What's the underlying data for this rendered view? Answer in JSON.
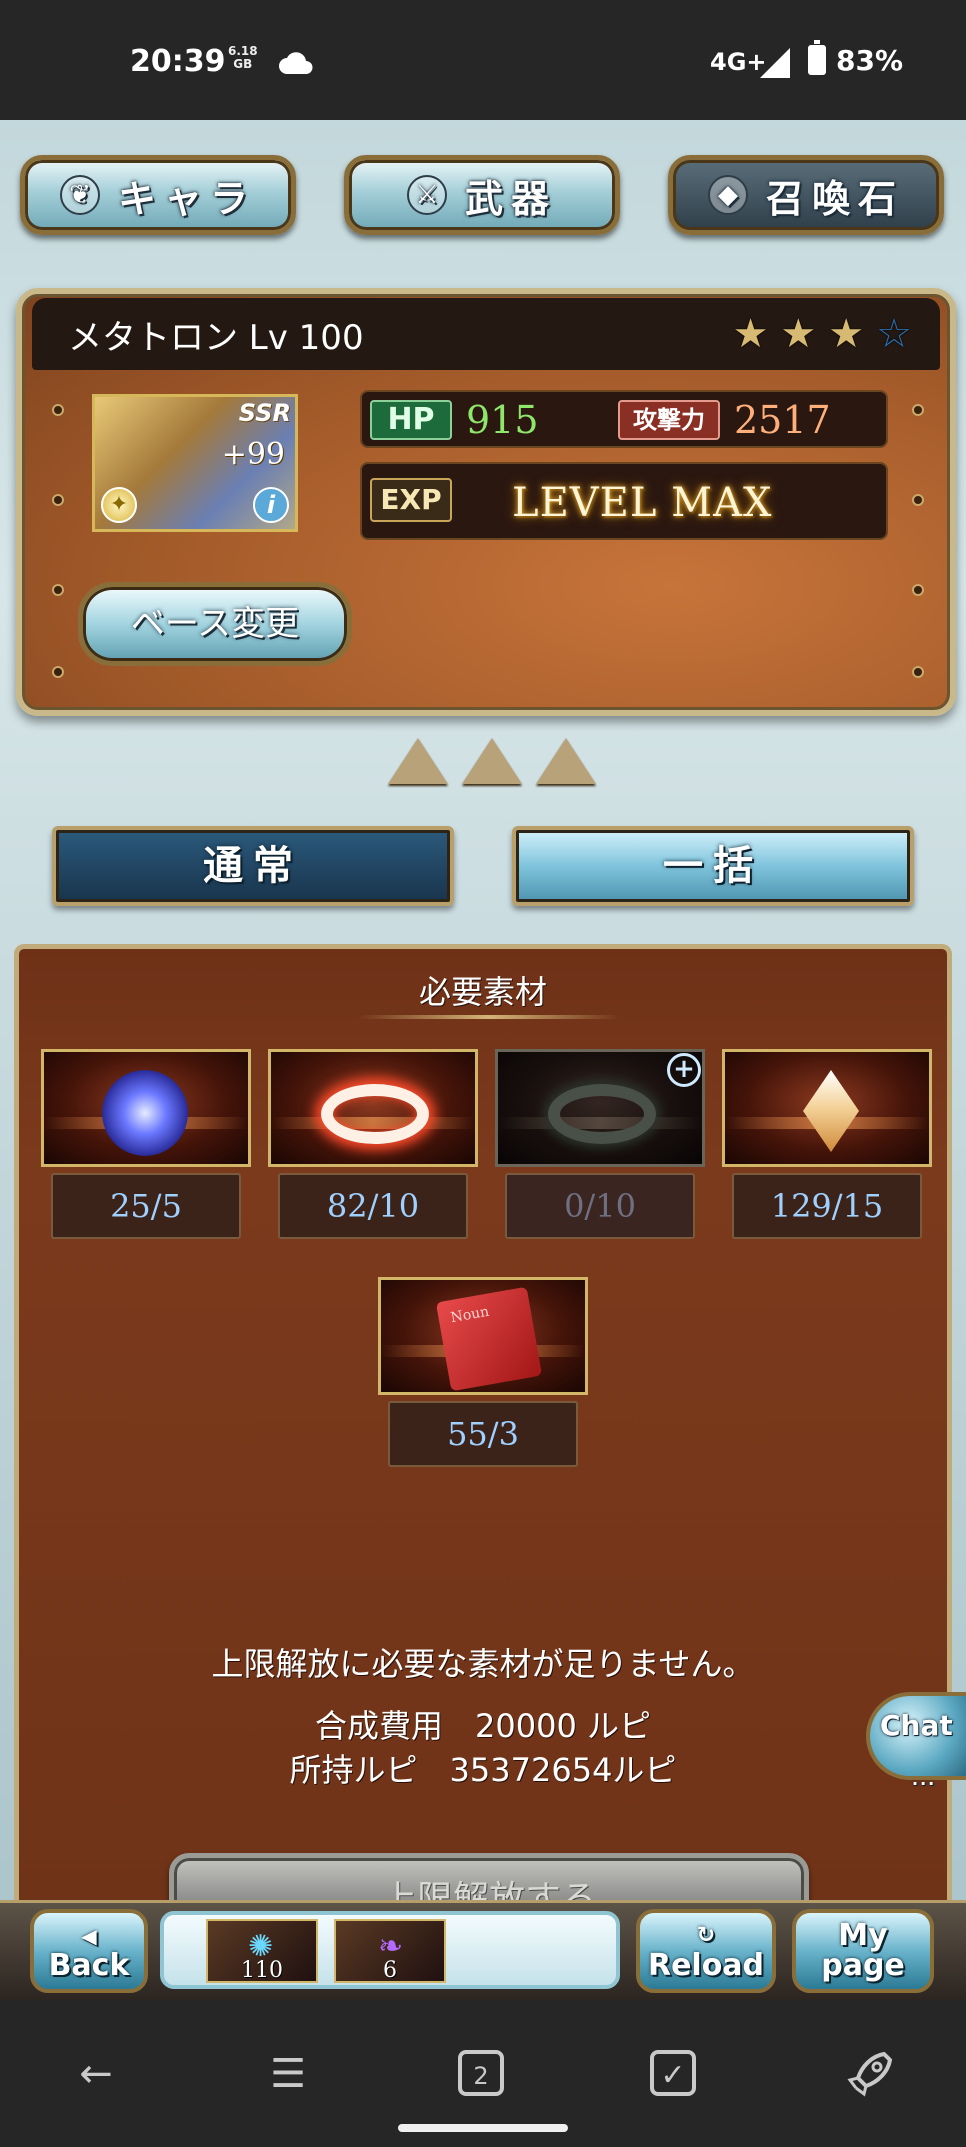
{
  "status_bar": {
    "time": "20:39",
    "net_speed": "6.18",
    "net_unit": "GB",
    "network": "4G+",
    "battery": "83%"
  },
  "top_tabs": [
    {
      "label": "キャラ",
      "icon": "character-icon",
      "active": false
    },
    {
      "label": "武器",
      "icon": "weapon-icon",
      "active": false
    },
    {
      "label": "召喚石",
      "icon": "summon-stone-icon",
      "active": true
    }
  ],
  "character": {
    "name_level": "メタトロン Lv 100",
    "rarity": "SSR",
    "plus": "+99",
    "stars_filled": 3,
    "stars_total": 4,
    "hp_label": "HP",
    "hp": "915",
    "atk_label": "攻撃力",
    "atk": "2517",
    "exp_label": "EXP",
    "exp_status": "LEVEL MAX",
    "change_base": "ベース変更"
  },
  "uncap_level": 3,
  "mode_tabs": [
    {
      "label": "通常",
      "active": true
    },
    {
      "label": "一括",
      "active": false
    }
  ],
  "materials": {
    "title": "必要素材",
    "items": [
      {
        "icon": "lightning-orb-icon",
        "count": "25/5",
        "available": true
      },
      {
        "icon": "red-ring-icon",
        "count": "82/10",
        "available": true
      },
      {
        "icon": "green-ring-icon",
        "count": "0/10",
        "available": false
      },
      {
        "icon": "crystal-icon",
        "count": "129/15",
        "available": true
      },
      {
        "icon": "scroll-icon",
        "count": "55/3",
        "available": true
      }
    ],
    "warning": "上限解放に必要な素材が足りません。",
    "cost_line": "合成費用　20000 ルピ",
    "owned_line": "所持ルピ　35372654ルピ",
    "uncap_button": "上限解放する"
  },
  "chat": {
    "label": "Chat",
    "dots": "..."
  },
  "footer": {
    "back": "Back",
    "reload": "Reload",
    "mypage_1": "My",
    "mypage_2": "page",
    "tray": [
      {
        "icon": "blue-flower-icon",
        "count": "110"
      },
      {
        "icon": "purple-scroll-icon",
        "count": "6"
      }
    ]
  },
  "nav": {
    "back": "back-arrow-icon",
    "menu": "menu-icon",
    "tabs_count": "2",
    "task": "checkbox-icon",
    "rocket": "rocket-icon"
  }
}
